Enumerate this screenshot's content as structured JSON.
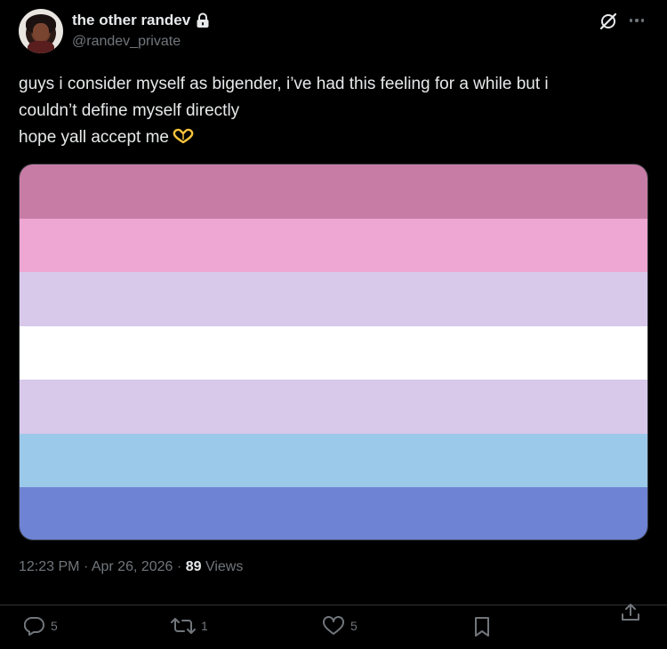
{
  "author": {
    "display_name": "the other randev",
    "handle": "@randev_private",
    "protected": true
  },
  "tweet": {
    "text_lines": [
      "guys i consider myself as bigender, i’ve had this feeling for a while but i",
      "couldn’t define myself directly",
      "hope yall accept me"
    ],
    "emoji": "heart-hands-icon",
    "media": {
      "type": "image",
      "stripes": [
        "#c67ca5",
        "#eea6d2",
        "#d8c8ea",
        "#ffffff",
        "#d8c8ea",
        "#9bc9e9",
        "#6e83d3"
      ]
    },
    "time": "12:23 PM",
    "date": "Apr 26, 2026",
    "separator": "·",
    "views_count": "89",
    "views_label": "Views"
  },
  "actions": {
    "replies": "5",
    "reposts": "1",
    "likes": "5",
    "bookmark_icon": "bookmark-icon",
    "share_icon": "share-icon"
  },
  "colors": {
    "background": "#000000",
    "text_primary": "#e7e9ea",
    "text_secondary": "#71767b",
    "divider": "#2f3336"
  }
}
